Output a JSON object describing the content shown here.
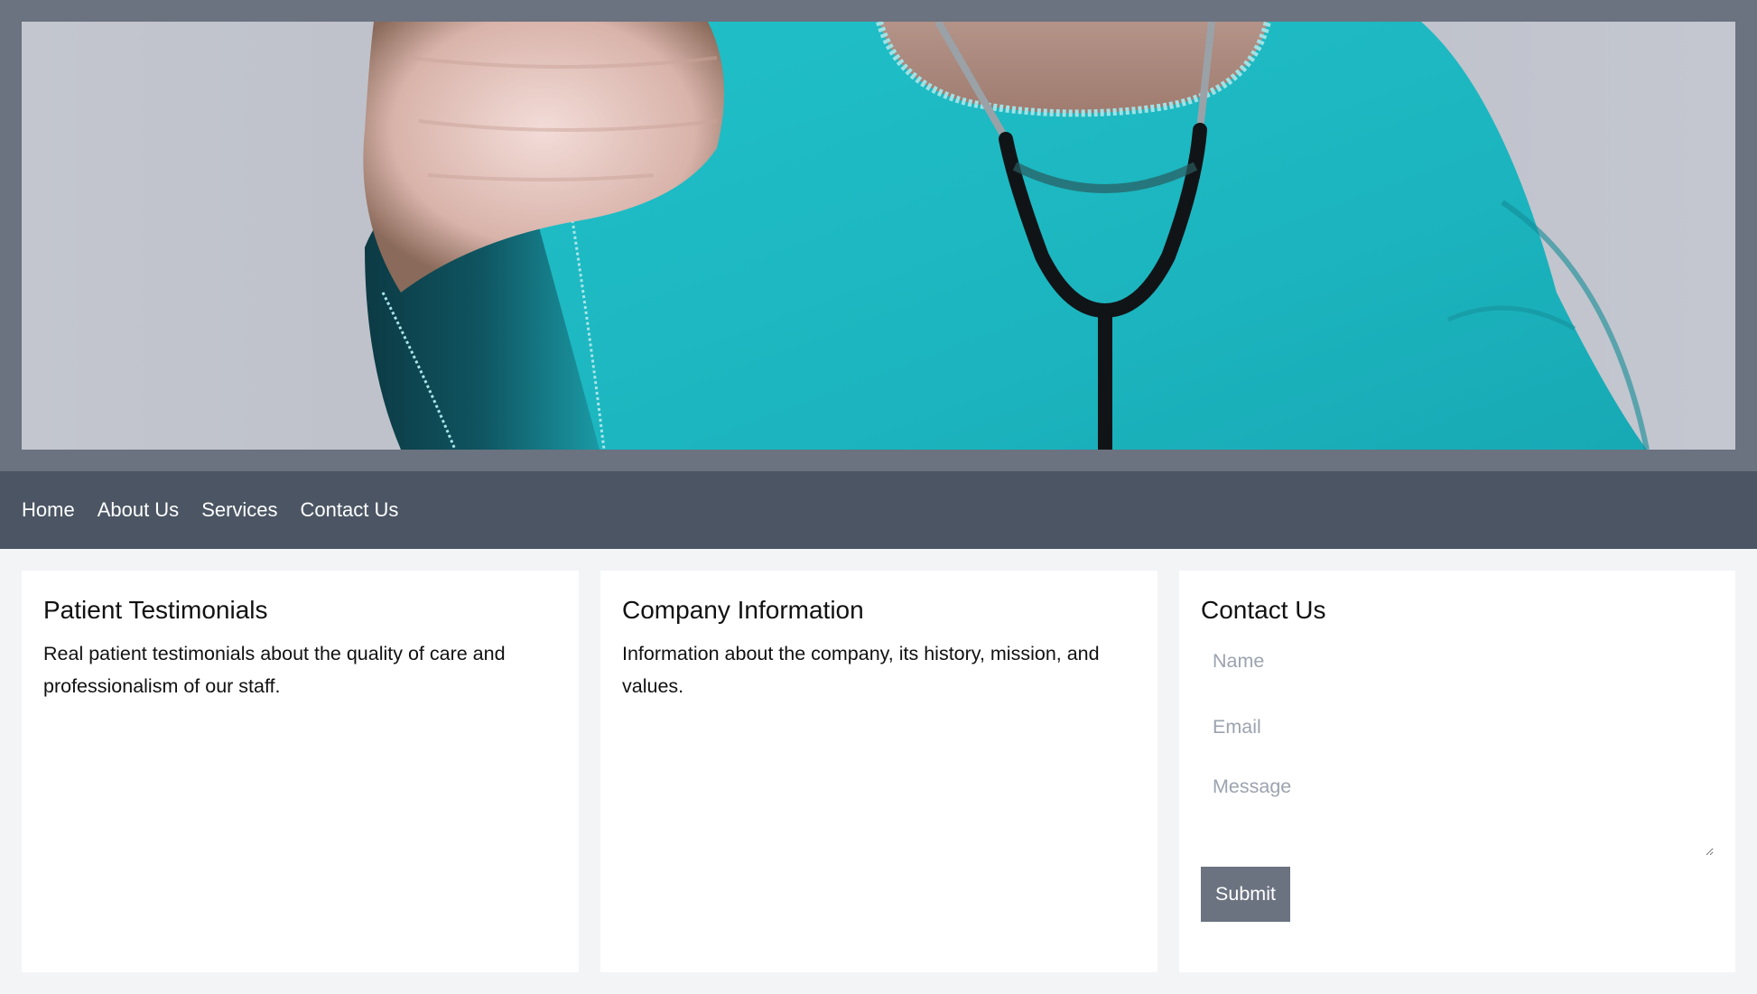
{
  "header": {
    "hero_image": {
      "description": "Doctor in teal scrubs with stethoscope around neck, fist extended toward camera",
      "icon": "hero-photo"
    }
  },
  "nav": {
    "links": [
      {
        "label": "Home"
      },
      {
        "label": "About Us"
      },
      {
        "label": "Services"
      },
      {
        "label": "Contact Us"
      }
    ]
  },
  "cards": [
    {
      "title": "Patient Testimonials",
      "body": "Real patient testimonials about the quality of care and professionalism of our staff."
    },
    {
      "title": "Company Information",
      "body": "Information about the company, its history, mission, and values."
    },
    {
      "title": "Contact Us",
      "form": {
        "name_placeholder": "Name",
        "email_placeholder": "Email",
        "message_placeholder": "Message",
        "name_value": "",
        "email_value": "",
        "message_value": "",
        "submit_label": "Submit"
      }
    }
  ],
  "colors": {
    "header_bg": "#6b7280",
    "nav_bg": "#4b5563",
    "page_bg": "#f3f4f6",
    "button_bg": "#6b7280",
    "scrubs_teal": "#1fb8c2"
  }
}
